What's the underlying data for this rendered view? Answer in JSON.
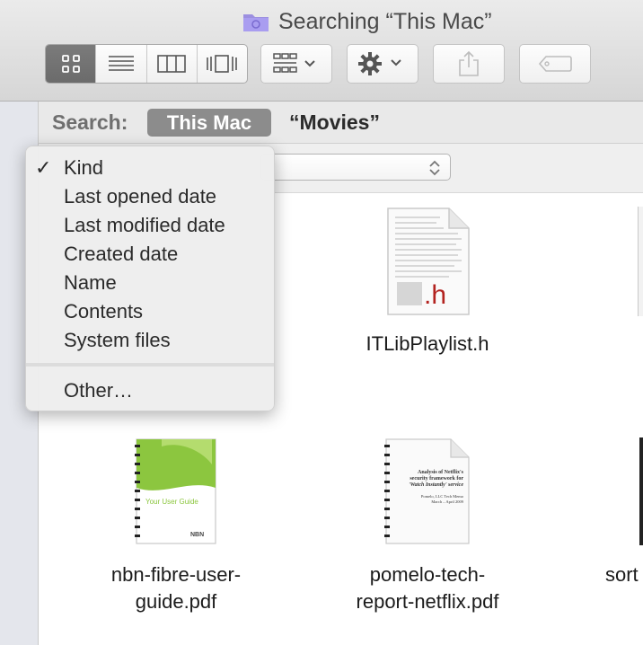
{
  "window": {
    "title": "Searching “This Mac”"
  },
  "toolbar": {
    "view_modes": [
      "icon-view",
      "list-view",
      "column-view",
      "cover-flow-view"
    ],
    "active_view": "icon-view"
  },
  "search": {
    "label": "Search:",
    "scope_active": "This Mac",
    "scope_folder": "“Movies”"
  },
  "menu": {
    "checked": "✓",
    "items": [
      "Kind",
      "Last opened date",
      "Last modified date",
      "Created date",
      "Name",
      "Contents",
      "System files"
    ],
    "other": "Other…"
  },
  "files": [
    {
      "name": "ITLibPlaylist.h",
      "icon": "header-file-icon"
    },
    {
      "name_line1": "nbn-fibre-user-",
      "name_line2": "guide.pdf",
      "icon": "pdf-document-icon",
      "cover_text": "Your User Guide",
      "cover_badge": "NBN"
    },
    {
      "name_line1": "pomelo-tech-",
      "name_line2": "report-netflix.pdf",
      "icon": "pdf-document-icon",
      "cover_lines": [
        "Analysis of Netflix's",
        "security framework for",
        "'Watch Instantly' service",
        "Pomelo, LLC Tech Memo",
        "March – April 2009"
      ]
    },
    {
      "name_line1": "sort",
      "icon": "document-icon"
    }
  ],
  "colors": {
    "menu_bg": "#eeeeee",
    "scope_bg": "#8c8c8c",
    "accent_green": "#8cc63f"
  }
}
